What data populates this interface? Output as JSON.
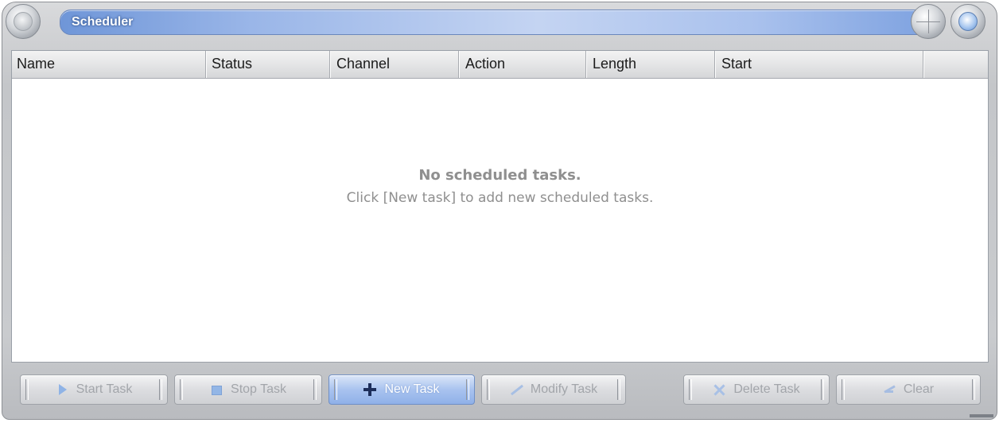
{
  "window": {
    "title": "Scheduler"
  },
  "list": {
    "columns": [
      "Name",
      "Status",
      "Channel",
      "Action",
      "Length",
      "Start",
      ""
    ],
    "empty_title": "No scheduled tasks.",
    "empty_hint": "Click [New task] to add new scheduled tasks."
  },
  "toolbar": {
    "start_task": "Start Task",
    "stop_task": "Stop Task",
    "new_task": "New Task",
    "modify_task": "Modify Task",
    "delete_task": "Delete Task",
    "clear": "Clear"
  }
}
